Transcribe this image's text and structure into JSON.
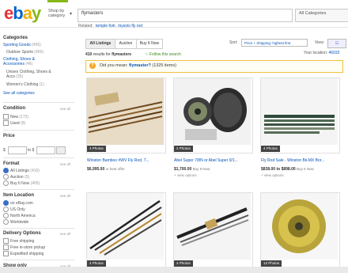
{
  "header": {
    "logo_letters": [
      "e",
      "b",
      "a",
      "y"
    ],
    "logo_colors": [
      "#e53238",
      "#0064d2",
      "#f5af02",
      "#86b817"
    ],
    "shop_by": "Shop by category",
    "search_value": "flymasters",
    "category_select": "All Categories"
  },
  "related": {
    "label": "Related:",
    "links": [
      "temple fork",
      "mysolo fly rod"
    ]
  },
  "sidebar": {
    "categories_title": "Categories",
    "categories": [
      {
        "label": "Sporting Goods",
        "count": "(455)",
        "type": "link"
      },
      {
        "label": "Outdoor Sports",
        "count": "(455)",
        "type": "sub"
      },
      {
        "label": "Clothing, Shoes & Accessories",
        "count": "(46)",
        "type": "link"
      },
      {
        "label": "Unisex Clothing, Shoes & Accs",
        "count": "(35)",
        "type": "sub"
      },
      {
        "label": "Women's Clothing",
        "count": "(1)",
        "type": "sub"
      }
    ],
    "see_all_categories": "See all categories",
    "condition_title": "Condition",
    "condition_see_all": "see all",
    "condition_options": [
      {
        "label": "New",
        "count": "(172)"
      },
      {
        "label": "Used",
        "count": "(8)"
      }
    ],
    "price_title": "Price",
    "price_from": "$",
    "price_to": "to $",
    "format_title": "Format",
    "format_see_all": "see all",
    "format_options": [
      {
        "label": "All Listings",
        "count": "(410)",
        "selected": true
      },
      {
        "label": "Auction",
        "count": "(5)",
        "selected": false
      },
      {
        "label": "Buy It Now",
        "count": "(405)",
        "selected": false
      }
    ],
    "location_title": "Item Location",
    "location_see_all": "see all",
    "location_options": [
      {
        "label": "on eBay.com",
        "selected": true
      },
      {
        "label": "US Only",
        "selected": false
      },
      {
        "label": "North America",
        "selected": false
      },
      {
        "label": "Worldwide",
        "selected": false
      }
    ],
    "delivery_title": "Delivery Options",
    "delivery_see_all": "see all",
    "delivery_options": [
      "Free shipping",
      "Free in-store pickup",
      "Expedited shipping"
    ],
    "show_only_title": "Show only",
    "show_only_see_all": "see all"
  },
  "toolbar": {
    "tabs": [
      "All Listings",
      "Auction",
      "Buy It Now"
    ],
    "sort_label": "Sort:",
    "sort_value": "Price + Shipping: highest first",
    "view_label": "View:",
    "view_value": "☷",
    "results_count": "410",
    "results_text": "results for",
    "results_query": "flymasters",
    "follow_label": "Follow this search",
    "location_label": "Your location:",
    "location_zip": "46032"
  },
  "did_you_mean": {
    "prefix": "Did you mean:",
    "suggestion": "flymaster?",
    "suffix": "(1325 items)"
  },
  "listings": [
    {
      "badge": "4 Photos",
      "title": "Winston Bamboo #WV Fly Rod, 7...",
      "price": "$6,995.00",
      "price_note": "or best offer",
      "more": "",
      "thumb": "rods-wood"
    },
    {
      "badge": "2 Photos",
      "title": "Abel Super 7/8N or Abel Super 9/1...",
      "price": "$1,700.00",
      "price_note": "Buy It Now",
      "more": "+ view options",
      "thumb": "reels-box"
    },
    {
      "badge": "4 Photos",
      "title": "Fly Rod Sale - Winston Bii-MX Bor...",
      "price": "$838.00 to $898.00",
      "price_note": "Buy It Now",
      "more": "+ view options",
      "thumb": "rods-case"
    },
    {
      "badge": "4 Photos",
      "title": "",
      "price": "",
      "price_note": "",
      "more": "",
      "thumb": "rods-dark"
    },
    {
      "badge": "4 Photos",
      "title": "",
      "price": "",
      "price_note": "",
      "more": "",
      "thumb": "rods-tube"
    },
    {
      "badge": "12 Photos",
      "title": "",
      "price": "",
      "price_note": "",
      "more": "",
      "thumb": "reel-gold"
    }
  ]
}
